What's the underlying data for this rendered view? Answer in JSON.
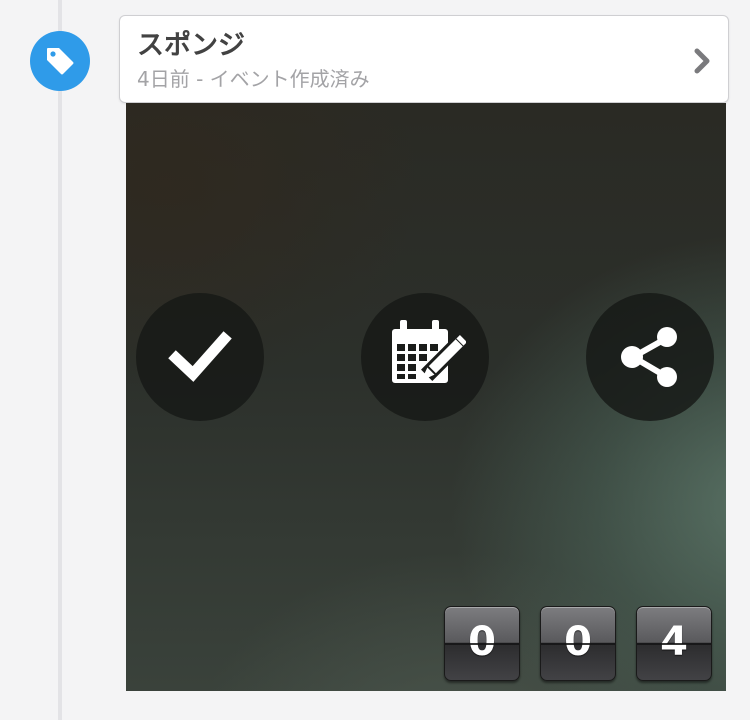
{
  "item": {
    "title": "スポンジ",
    "subtitle": "4日前 - イベント作成済み"
  },
  "icons": {
    "badge": "tag-icon",
    "open": "chevron-right-icon",
    "done": "checkmark-icon",
    "event": "calendar-edit-icon",
    "share": "share-icon"
  },
  "colors": {
    "badge": "#2f9be9",
    "title": "#424242",
    "subtitle": "#a3a3a6"
  },
  "counter": {
    "digits": [
      "0",
      "0",
      "4"
    ]
  }
}
